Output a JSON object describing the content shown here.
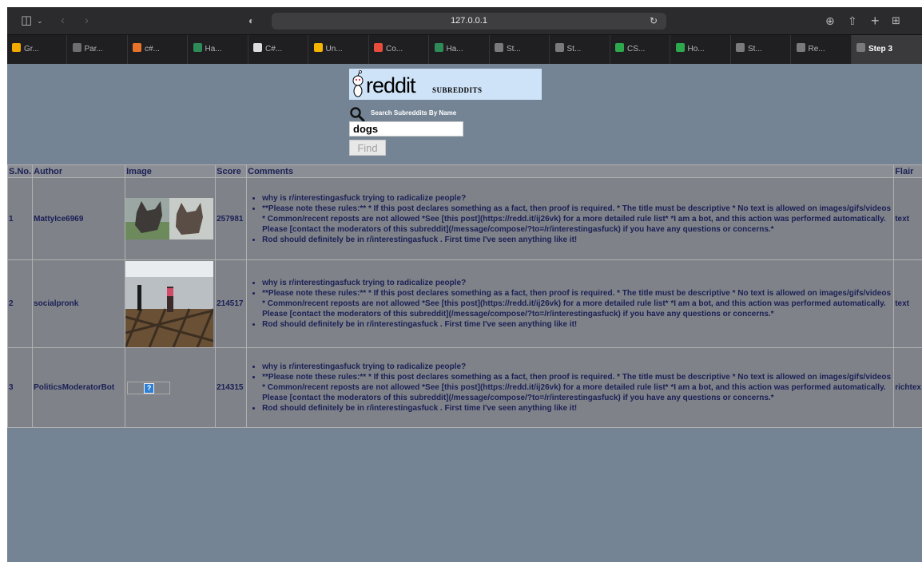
{
  "browser": {
    "url": "127.0.0.1",
    "tabs": [
      {
        "label": "Gr...",
        "color": "#f2a900"
      },
      {
        "label": "Par...",
        "color": "#6e6e6e"
      },
      {
        "label": "c#...",
        "color": "#e8742c"
      },
      {
        "label": "Ha...",
        "color": "#2e8b57"
      },
      {
        "label": "C#...",
        "color": "#dcdcdc"
      },
      {
        "label": "Un...",
        "color": "#f5b400"
      },
      {
        "label": "Co...",
        "color": "#e84c3d"
      },
      {
        "label": "Ha...",
        "color": "#2e8b57"
      },
      {
        "label": "St...",
        "color": "#7a7a7a"
      },
      {
        "label": "St...",
        "color": "#7a7a7a"
      },
      {
        "label": "CS...",
        "color": "#2ea84c"
      },
      {
        "label": "Ho...",
        "color": "#2ea84c"
      },
      {
        "label": "St...",
        "color": "#7a7a7a"
      },
      {
        "label": "Re...",
        "color": "#7a7a7a"
      },
      {
        "label": "Step 3",
        "color": "#7a7a7a"
      }
    ]
  },
  "header": {
    "logo_text": "reddit",
    "logo_sub": "SUBREDDITS",
    "search_label": "Search Subreddits By Name",
    "search_value": "dogs",
    "find_label": "Find"
  },
  "table": {
    "columns": [
      "S.No.",
      "Author",
      "Image",
      "Score",
      "Comments",
      "Flair"
    ],
    "comments": [
      "why is r/interestingasfuck trying to radicalize people?",
      "**Please note these rules:** * If this post declares something as a fact, then proof is required. * The title must be descriptive * No text is allowed on images/gifs/videos * Common/recent reposts are not allowed *See [this post](https://redd.it/ij26vk) for a more detailed rule list* *I am a bot, and this action was performed automatically. Please [contact the moderators of this subreddit](/message/compose/?to=/r/interestingasfuck) if you have any questions or concerns.*",
      "Rod should definitely be in r/interestingasfuck . First time I've seen anything like it!"
    ],
    "rows": [
      {
        "sno": "1",
        "author": "MattyIce6969",
        "score": "257981",
        "flair": "text",
        "image": "dog"
      },
      {
        "sno": "2",
        "author": "socialpronk",
        "score": "214517",
        "flair": "text",
        "image": "dogshow"
      },
      {
        "sno": "3",
        "author": "PoliticsModeratorBot",
        "score": "214315",
        "flair": "richtex",
        "image": "broken"
      }
    ]
  }
}
